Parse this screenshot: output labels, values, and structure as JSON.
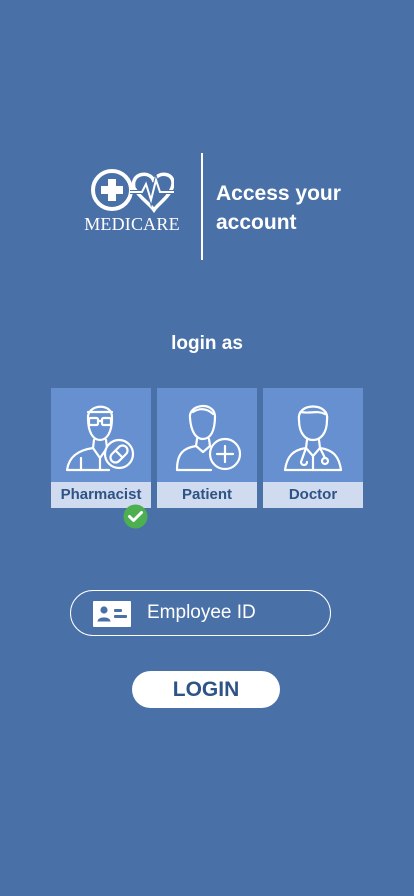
{
  "brand": {
    "name": "MEDICARE"
  },
  "header": {
    "title": "Access your account"
  },
  "roles": {
    "heading": "login as",
    "items": [
      {
        "label": "Pharmacist",
        "icon": "pharmacist-icon",
        "selected": true
      },
      {
        "label": "Patient",
        "icon": "patient-icon",
        "selected": false
      },
      {
        "label": "Doctor",
        "icon": "doctor-icon",
        "selected": false
      }
    ]
  },
  "form": {
    "employee_id": {
      "placeholder": "Employee ID",
      "value": "",
      "icon": "id-card-icon"
    },
    "login_label": "LOGIN"
  },
  "colors": {
    "background": "#4a70a8",
    "card": "#6690d0",
    "card_label": "#d0dbef",
    "accent_text": "#2e5386",
    "selected_check": "#4caf50"
  }
}
